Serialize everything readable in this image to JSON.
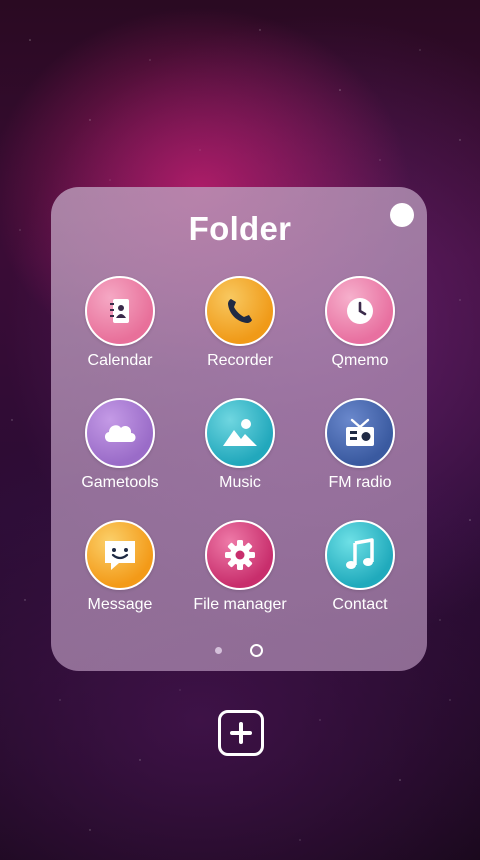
{
  "folder": {
    "title": "Folder"
  },
  "apps": [
    {
      "label": "Calendar",
      "icon": "contacts-book-icon",
      "color": "#e8709a"
    },
    {
      "label": "Recorder",
      "icon": "phone-icon",
      "color": "#f3a020"
    },
    {
      "label": "Qmemo",
      "icon": "clock-icon",
      "color": "#e870a0"
    },
    {
      "label": "Gametools",
      "icon": "cloud-icon",
      "color": "#9a6cc8"
    },
    {
      "label": "Music",
      "icon": "gallery-icon",
      "color": "#2fb6c8"
    },
    {
      "label": "FM radio",
      "icon": "radio-icon",
      "color": "#3f5fa8"
    },
    {
      "label": "Message",
      "icon": "chat-smile-icon",
      "color": "#f6a623"
    },
    {
      "label": "File manager",
      "icon": "gear-icon",
      "color": "#d03c78"
    },
    {
      "label": "Contact",
      "icon": "music-note-icon",
      "color": "#2ab8c4"
    }
  ],
  "pager": {
    "pages": 2,
    "current": 2
  }
}
